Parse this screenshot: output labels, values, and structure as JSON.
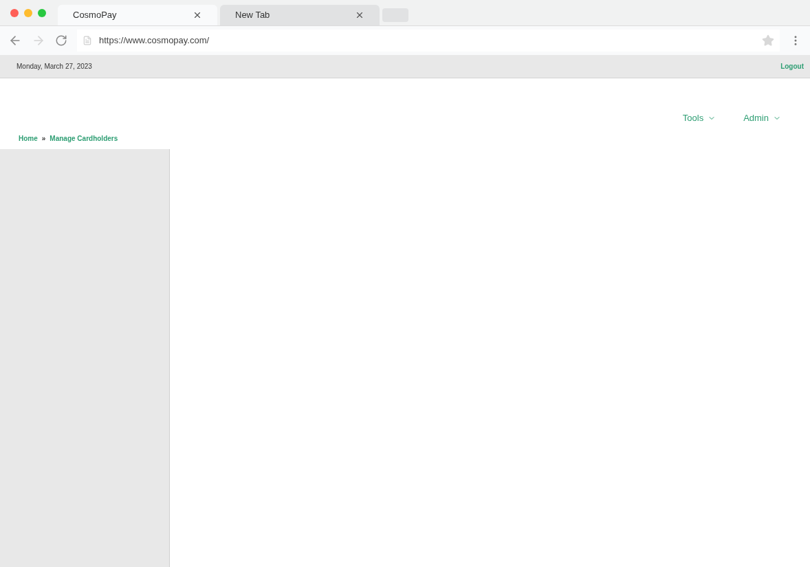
{
  "browser": {
    "tabs": [
      {
        "label": "CosmoPay",
        "selected": true
      },
      {
        "label": "New Tab",
        "selected": false
      }
    ],
    "url": "https://www.cosmopay.com/"
  },
  "top_bar": {
    "date": "Monday, March 27, 2023",
    "logout": "Logout"
  },
  "nav": [
    {
      "label": "Tools"
    },
    {
      "label": "Admin"
    }
  ],
  "breadcrumb": {
    "items": [
      "Home",
      "Manage Cardholders"
    ],
    "separator": "»"
  }
}
